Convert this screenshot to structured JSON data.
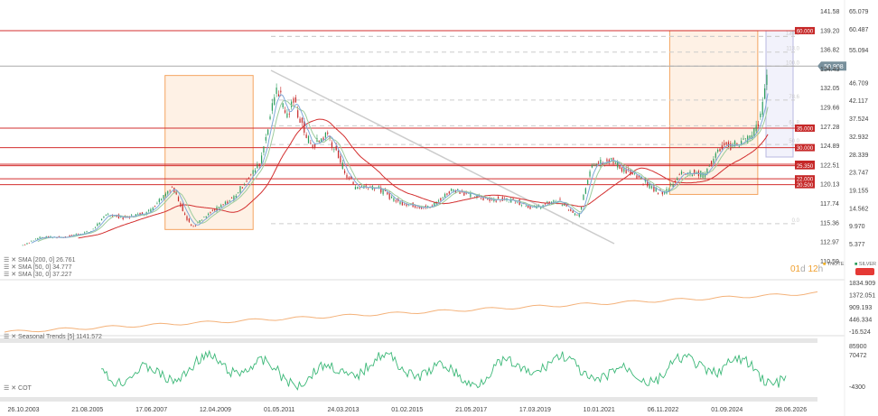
{
  "chart_data": {
    "type": "candlestick",
    "symbol_main": "SILVER",
    "symbol_compare": "TNOTE",
    "timer": {
      "a": "01",
      "b": "d",
      "c": "12",
      "d": "h"
    },
    "current_price": "50.908",
    "right_axis": [
      "65.079",
      "60.487",
      "55.094",
      "50.908",
      "46.709",
      "42.117",
      "37.524",
      "32.932",
      "28.339",
      "23.747",
      "19.155",
      "14.562",
      "9.970",
      "5.377"
    ],
    "right_axis_values": [
      65.079,
      60.487,
      55.094,
      50.908,
      46.709,
      42.117,
      37.524,
      32.932,
      28.339,
      23.747,
      19.155,
      14.562,
      9.97,
      5.377
    ],
    "left_axis": [
      "141.58",
      "139.20",
      "136.82",
      "134.43",
      "132.05",
      "129.66",
      "127.28",
      "124.89",
      "122.51",
      "120.13",
      "117.74",
      "115.36",
      "112.97",
      "110.59"
    ],
    "fib_labels": [
      "138.2",
      "123.6",
      "113.0",
      "100.0",
      "78.6",
      "61.8",
      "50.0",
      "0.0"
    ],
    "fib_values": [
      58.5,
      58.5,
      54.5,
      50.9,
      42.2,
      35.6,
      30.8,
      10.5
    ],
    "levels": [
      {
        "label": "60.000",
        "value": 60.0
      },
      {
        "label": "35.000",
        "value": 35.0
      },
      {
        "label": "30.000",
        "value": 30.0
      },
      {
        "label": "25.750",
        "value": 25.75
      },
      {
        "label": "25.350",
        "value": 25.35
      },
      {
        "label": "22.000",
        "value": 22.0
      },
      {
        "label": "20.500",
        "value": 20.5
      }
    ],
    "path": [
      [
        2003.8,
        5.0
      ],
      [
        2004.3,
        7.0
      ],
      [
        2005.0,
        7.0
      ],
      [
        2005.8,
        8.5
      ],
      [
        2006.3,
        13.0
      ],
      [
        2006.8,
        12.0
      ],
      [
        2007.5,
        13.5
      ],
      [
        2008.2,
        20.0
      ],
      [
        2008.8,
        9.5
      ],
      [
        2009.3,
        13.0
      ],
      [
        2010.0,
        17.0
      ],
      [
        2010.8,
        26.0
      ],
      [
        2011.3,
        46.0
      ],
      [
        2011.6,
        38.0
      ],
      [
        2011.8,
        42.0
      ],
      [
        2012.3,
        30.0
      ],
      [
        2012.8,
        33.5
      ],
      [
        2013.3,
        24.0
      ],
      [
        2013.6,
        20.0
      ],
      [
        2014.2,
        20.0
      ],
      [
        2014.9,
        16.0
      ],
      [
        2015.8,
        14.5
      ],
      [
        2016.5,
        19.5
      ],
      [
        2017.3,
        17.0
      ],
      [
        2018.3,
        16.5
      ],
      [
        2018.9,
        14.5
      ],
      [
        2019.6,
        16.5
      ],
      [
        2020.2,
        12.0
      ],
      [
        2020.6,
        26.0
      ],
      [
        2021.1,
        27.0
      ],
      [
        2021.8,
        23.0
      ],
      [
        2022.7,
        18.0
      ],
      [
        2023.3,
        24.0
      ],
      [
        2023.9,
        23.0
      ],
      [
        2024.4,
        30.0
      ],
      [
        2024.9,
        31.0
      ],
      [
        2025.3,
        32.5
      ],
      [
        2025.6,
        38.0
      ],
      [
        2025.8,
        50.9
      ]
    ],
    "x_range": [
      2003.82,
      2026.49
    ],
    "date_labels": [
      "26.10.2003",
      "21.08.2005",
      "17.06.2007",
      "12.04.2009",
      "01.05.2011",
      "24.03.2013",
      "01.02.2015",
      "21.05.2017",
      "17.03.2019",
      "10.01.2021",
      "06.11.2022",
      "01.09.2024",
      "28.06.2026"
    ],
    "indicators": [
      {
        "label": "SMA [200, 0] 26.761",
        "color": "#d32f2f",
        "period": 52
      },
      {
        "label": "SMA [50, 0] 34.777",
        "color": "#9ccc9c",
        "period": 14
      },
      {
        "label": "SMA [30, 0] 37.227",
        "color": "#7fa8d8",
        "period": 8
      }
    ],
    "boxes": [
      {
        "from": 2008.0,
        "to": 2010.6,
        "low": 9.0,
        "high": 48.5
      },
      {
        "from": 2022.9,
        "to": 2025.5,
        "low": 18.0,
        "high": 60.0
      }
    ],
    "seasonal": {
      "label": "Seasonal Trends [5] 1141.572",
      "axis": [
        "1834.909",
        "1372.051",
        "909.193",
        "446.334",
        "-16.524"
      ]
    },
    "cot": {
      "label": "COT",
      "axis": [
        "85900",
        "70472",
        "-4300"
      ]
    }
  }
}
